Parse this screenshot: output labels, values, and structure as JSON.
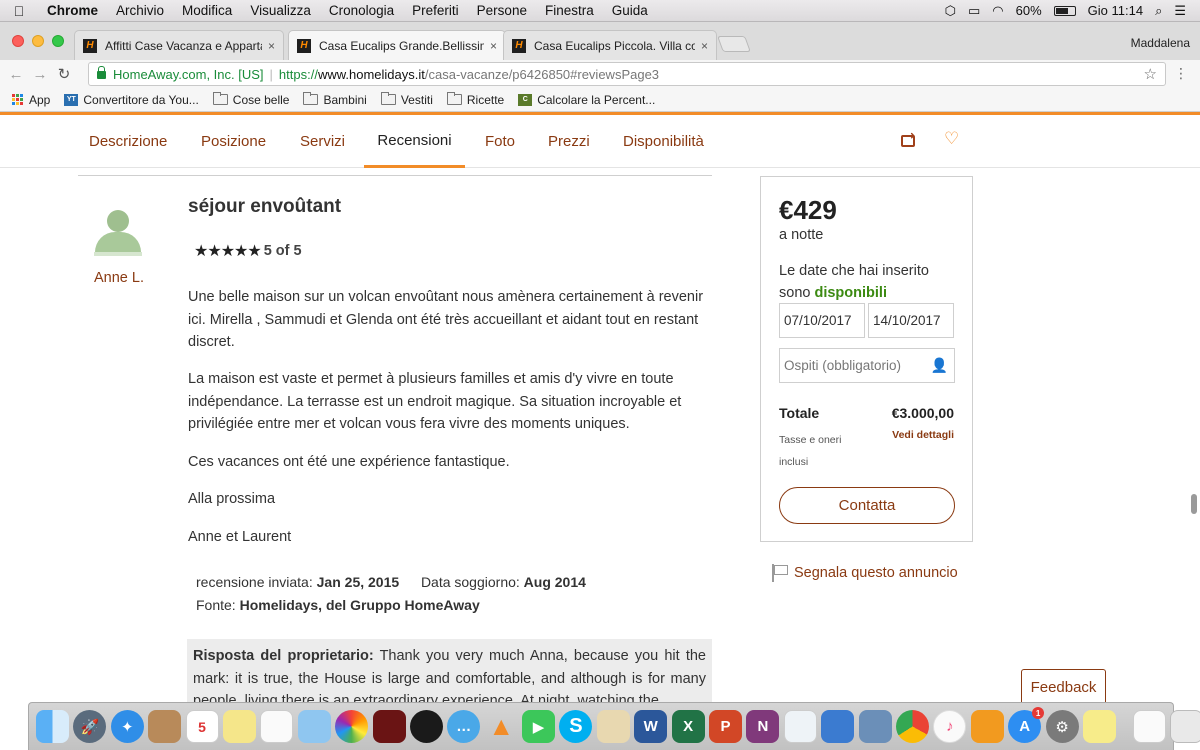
{
  "menubar": {
    "apple": "",
    "items": [
      "Chrome",
      "Archivio",
      "Modifica",
      "Visualizza",
      "Cronologia",
      "Preferiti",
      "Persone",
      "Finestra",
      "Guida"
    ],
    "battery": "60%",
    "clock": "Gio 11:14"
  },
  "tabs": [
    {
      "label": "Affitti Case Vacanza e Apparta",
      "close": "×"
    },
    {
      "label": "Casa Eucalips Grande.Bellissim",
      "close": "×"
    },
    {
      "label": "Casa Eucalips Piccola. Villa con",
      "close": "×"
    }
  ],
  "profile": "Maddalena",
  "address": {
    "ev": "HomeAway.com, Inc. [US]",
    "separator": "|",
    "scheme": "https://",
    "host": "www.homelidays.it",
    "path": "/casa-vacanze/p6426850#reviewsPage3"
  },
  "bookmarks": [
    "App",
    "Convertitore da You...",
    "Cose belle",
    "Bambini",
    "Vestiti",
    "Ricette",
    "Calcolare la Percent..."
  ],
  "subnav": {
    "tabs": [
      "Descrizione",
      "Posizione",
      "Servizi",
      "Recensioni",
      "Foto",
      "Prezzi",
      "Disponibilità"
    ],
    "active": "Recensioni"
  },
  "review": {
    "reviewer": "Anne L.",
    "title": "séjour envoûtant",
    "rating": 5,
    "rating_text": "5 of 5",
    "paragraphs": [
      "Une belle maison sur un volcan envoûtant nous amènera certainement à revenir ici. Mirella , Sammudi et Glenda ont été très accueillant et aidant tout en restant discret.",
      "La maison est vaste et permet à plusieurs familles et amis d'y vivre en toute indépendance. La terrasse est un endroit magique. Sa situation incroyable et privilégiée entre mer et volcan vous fera vivre des moments uniques.",
      "Ces vacances ont été une expérience fantastique.",
      "Alla prossima",
      "Anne et Laurent"
    ],
    "submitted_label": "recensione inviata:",
    "submitted_value": "Jan 25, 2015",
    "stay_label": "Data soggiorno:",
    "stay_value": "Aug 2014",
    "source_label": "Fonte:",
    "source_value": "Homelidays, del Gruppo HomeAway",
    "owner_reply_label": "Risposta del proprietario:",
    "owner_reply_text": "Thank you very much Anna, because you hit the mark: it is true, the House is large and comfortable, and although is for many people, living there is an extraordinary experience. At night, watching the"
  },
  "booking": {
    "price": "€429",
    "per": "a notte",
    "avail_text": "Le date che hai inserito sono",
    "avail_status": "disponibili",
    "checkin": "07/10/2017",
    "checkout": "14/10/2017",
    "guests_placeholder": "Ospiti (obbligatorio)",
    "total_label": "Totale",
    "total_value": "€3.000,00",
    "tax_label": "Tasse e oneri inclusi",
    "details_link": "Vedi dettagli",
    "contact_button": "Contatta"
  },
  "report_link": "Segnala questo annuncio",
  "feedback_button": "Feedback",
  "dock": {
    "calendar_day": "5",
    "appstore_badge": "1"
  },
  "colors": {
    "brand_orange": "#f28c28",
    "link_brown": "#8a3a12",
    "available_green": "#3c8a12"
  }
}
